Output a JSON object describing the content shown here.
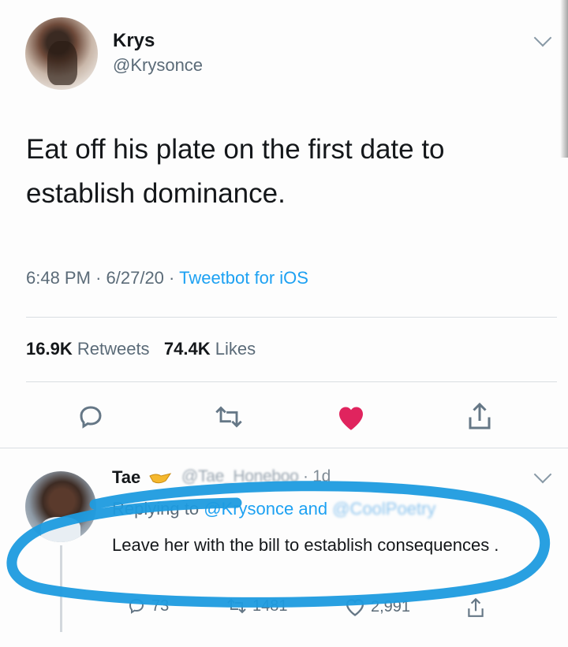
{
  "tweet": {
    "display_name": "Krys",
    "handle": "@Krysonce",
    "text": "Eat off his plate on the first date to establish dominance.",
    "time": "6:48 PM",
    "date": "6/27/20",
    "source": "Tweetbot for iOS",
    "retweets_count": "16.9K",
    "retweets_label": "Retweets",
    "likes_count": "74.4K",
    "likes_label": "Likes",
    "icons": [
      "reply-icon",
      "retweet-icon",
      "heart-icon",
      "share-icon"
    ],
    "colors": {
      "like": "#e0245e",
      "link": "#1da1f2",
      "annotation": "#1e9bdf"
    }
  },
  "reply": {
    "display_name": "Tae",
    "handle": "@Tae_Honeboo",
    "age": "1d",
    "replying_prefix": "Replying to",
    "replying_mention": "@Krysonce",
    "replying_and": "and",
    "replying_mention_2": "@CoolPoetry",
    "text": "Leave her with the bill to establish consequences .",
    "retweets": "1481",
    "likes": "2,991",
    "replies": "73"
  }
}
